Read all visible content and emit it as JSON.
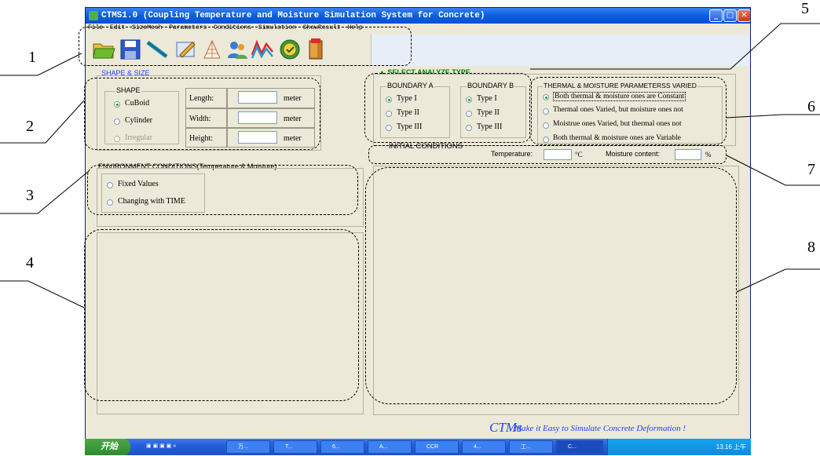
{
  "annotations": {
    "n1": "1",
    "n2": "2",
    "n3": "3",
    "n4": "4",
    "n5": "5",
    "n6": "6",
    "n7": "7",
    "n8": "8"
  },
  "window": {
    "title": "CTMS1.0 (Coupling Temperature and Moisture Simulation System for Concrete)",
    "min_label": "_",
    "max_label": "□",
    "close_label": "✕"
  },
  "menu": [
    "File",
    "Edit",
    "SizeMesh",
    "Parameters",
    "Conditions",
    "Simulation",
    "ShowResult",
    "Help"
  ],
  "toolbar_icons": [
    "open-folder-icon",
    "save-icon",
    "line-draw-icon",
    "edit-pencil-icon",
    "mesh-icon",
    "users-icon",
    "wave-chart-icon",
    "badge-icon",
    "exit-door-icon"
  ],
  "shape_size": {
    "title": "SHAPE & SIZE",
    "shape_group": "SHAPE",
    "options": [
      "CuBoid",
      "Cylinder",
      "Irregular"
    ],
    "dims": [
      {
        "label": "Length:",
        "unit": "meter"
      },
      {
        "label": "Width:",
        "unit": "meter"
      },
      {
        "label": "Height:",
        "unit": "meter"
      }
    ]
  },
  "environment": {
    "title": "ENVIRONMENT CONDITIONS(Temperature & Moisture)",
    "options": [
      "Fixed Values",
      "Changing with TIME"
    ]
  },
  "analyze_type": {
    "title": "SELECT ANALYZE TYPE",
    "boundary_a": "BOUNDARY A",
    "boundary_b": "BOUNDARY B",
    "types": [
      "Type I",
      "Type II",
      "Type III"
    ]
  },
  "parameters": {
    "title": "THERMAL & MOISTURE PARAMETERSS VARIED",
    "options": [
      "Both thermal & moisture ones are Constant",
      "Thermal ones Varied, but moisture ones not",
      "Moistrue ones Varied, but thermal ones not",
      "Both thermal & moisture ones are Variable"
    ]
  },
  "initial_conditions": {
    "title": "INITIAL CONDITIONS",
    "temperature_label": "Temperature:",
    "temperature_unit": "°C",
    "moisture_label": "Moisture content:",
    "moisture_unit": "%"
  },
  "footer": {
    "logo": "CTMs",
    "slogan": "Make it Easy to Simulate Concrete Deformation !"
  },
  "taskbar": {
    "start": "开始",
    "tasks": [
      "万...",
      "T...",
      "6...",
      "A...",
      "CCR",
      "4...",
      "工...",
      "C..."
    ],
    "clock": "13.16 上午"
  },
  "colors": {
    "accent_green": "#008000",
    "accent_blue": "#1e40ff",
    "face": "#ece9d8",
    "title_blue": "#0a5fe0"
  }
}
